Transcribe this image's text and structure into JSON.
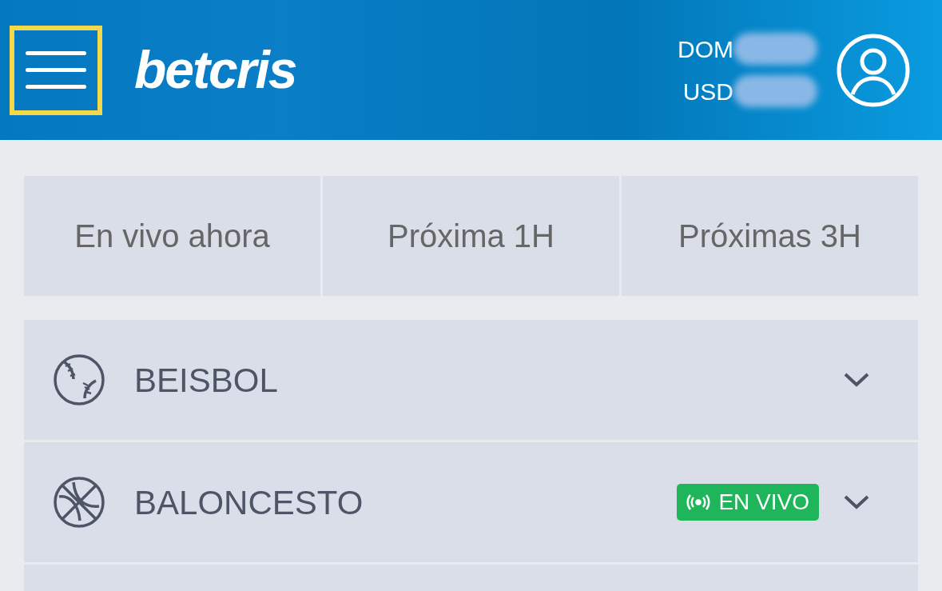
{
  "header": {
    "menu_button": {
      "highlighted": true
    },
    "logo": "betcris",
    "balances": [
      {
        "currency": "DOM"
      },
      {
        "currency": "USD"
      }
    ]
  },
  "filter_tabs": [
    {
      "label": "En vivo ahora",
      "selected": false
    },
    {
      "label": "Próxima 1H",
      "selected": false
    },
    {
      "label": "Próximas 3H",
      "selected": false
    }
  ],
  "sports": [
    {
      "kind": "baseball",
      "name": "BEISBOL",
      "expanded": false
    },
    {
      "kind": "basketball",
      "name": "BALONCESTO",
      "live_badge": "EN VIVO",
      "expanded": false
    },
    {
      "kind": "cut"
    }
  ]
}
